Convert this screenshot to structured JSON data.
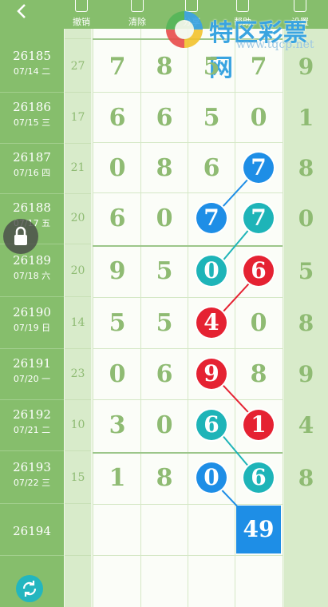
{
  "toolbar": {
    "undo_label": "撤销",
    "clear_label": "清除",
    "share_label": "分享",
    "help_label": "帮助",
    "settings_label": "设置"
  },
  "logo": {
    "name": "特区彩票网",
    "url": "www.tqcp.net"
  },
  "top_row": {
    "sum": "27",
    "digits": [
      "7",
      "8",
      "5",
      "7"
    ],
    "last": "9"
  },
  "rows": [
    {
      "issue": "26185",
      "date": "07/14 二",
      "sum": "27",
      "digits": [
        "7",
        "8",
        "5",
        "7"
      ],
      "last": "9"
    },
    {
      "issue": "26186",
      "date": "07/15 三",
      "sum": "17",
      "digits": [
        "6",
        "6",
        "5",
        "0"
      ],
      "last": "1"
    },
    {
      "issue": "26187",
      "date": "07/16 四",
      "sum": "21",
      "digits": [
        "0",
        "8",
        "6",
        "7"
      ],
      "last": "8"
    },
    {
      "issue": "26188",
      "date": "07/17 五",
      "sum": "20",
      "digits": [
        "6",
        "0",
        "7",
        "7"
      ],
      "last": "0"
    },
    {
      "issue": "26189",
      "date": "07/18 六",
      "sum": "20",
      "digits": [
        "9",
        "5",
        "0",
        "6"
      ],
      "last": "5"
    },
    {
      "issue": "26190",
      "date": "07/19 日",
      "sum": "14",
      "digits": [
        "5",
        "5",
        "4",
        "0"
      ],
      "last": "8"
    },
    {
      "issue": "26191",
      "date": "07/20 一",
      "sum": "23",
      "digits": [
        "0",
        "6",
        "9",
        "8"
      ],
      "last": "9"
    },
    {
      "issue": "26192",
      "date": "07/21 二",
      "sum": "10",
      "digits": [
        "3",
        "0",
        "6",
        "1"
      ],
      "last": "4"
    },
    {
      "issue": "26193",
      "date": "07/22 三",
      "sum": "15",
      "digits": [
        "1",
        "8",
        "0",
        "6"
      ],
      "last": "8"
    },
    {
      "issue": "26194",
      "date": "",
      "sum": "",
      "digits": [
        "",
        "",
        "",
        ""
      ],
      "last": ""
    }
  ],
  "prediction": "49",
  "colors": {
    "blue": "#1e8ee6",
    "teal": "#1eb4b8",
    "red": "#e52232",
    "green": "#86be6c"
  }
}
